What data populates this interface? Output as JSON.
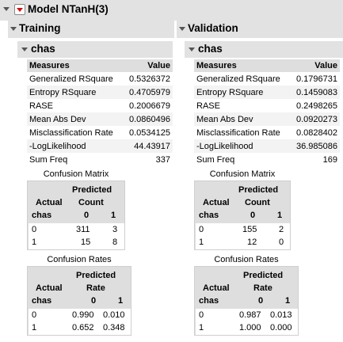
{
  "model": {
    "title": "Model NTanH(3)"
  },
  "panels": [
    {
      "title": "Training",
      "subtitle": "chas",
      "measures_header": "Measures",
      "value_header": "Value",
      "measures": [
        {
          "name": "Generalized RSquare",
          "value": "0.5326372"
        },
        {
          "name": "Entropy RSquare",
          "value": "0.4705979"
        },
        {
          "name": "RASE",
          "value": "0.2006679"
        },
        {
          "name": "Mean Abs Dev",
          "value": "0.0860496"
        },
        {
          "name": "Misclassification Rate",
          "value": "0.0534125"
        },
        {
          "name": "-LogLikelihood",
          "value": "44.43917"
        },
        {
          "name": "Sum Freq",
          "value": "337"
        }
      ],
      "confusion_matrix": {
        "caption": "Confusion Matrix",
        "predicted_label": "Predicted",
        "measure_label": "Count",
        "actual_label": "Actual",
        "row_var": "chas",
        "cols": [
          "0",
          "1"
        ],
        "rows": [
          {
            "label": "0",
            "values": [
              "311",
              "3"
            ]
          },
          {
            "label": "1",
            "values": [
              "15",
              "8"
            ]
          }
        ]
      },
      "confusion_rates": {
        "caption": "Confusion Rates",
        "predicted_label": "Predicted",
        "measure_label": "Rate",
        "actual_label": "Actual",
        "row_var": "chas",
        "cols": [
          "0",
          "1"
        ],
        "rows": [
          {
            "label": "0",
            "values": [
              "0.990",
              "0.010"
            ]
          },
          {
            "label": "1",
            "values": [
              "0.652",
              "0.348"
            ]
          }
        ]
      }
    },
    {
      "title": "Validation",
      "subtitle": "chas",
      "measures_header": "Measures",
      "value_header": "Value",
      "measures": [
        {
          "name": "Generalized RSquare",
          "value": "0.1796731"
        },
        {
          "name": "Entropy RSquare",
          "value": "0.1459083"
        },
        {
          "name": "RASE",
          "value": "0.2498265"
        },
        {
          "name": "Mean Abs Dev",
          "value": "0.0920273"
        },
        {
          "name": "Misclassification Rate",
          "value": "0.0828402"
        },
        {
          "name": "-LogLikelihood",
          "value": "36.985086"
        },
        {
          "name": "Sum Freq",
          "value": "169"
        }
      ],
      "confusion_matrix": {
        "caption": "Confusion Matrix",
        "predicted_label": "Predicted",
        "measure_label": "Count",
        "actual_label": "Actual",
        "row_var": "chas",
        "cols": [
          "0",
          "1"
        ],
        "rows": [
          {
            "label": "0",
            "values": [
              "155",
              "2"
            ]
          },
          {
            "label": "1",
            "values": [
              "12",
              "0"
            ]
          }
        ]
      },
      "confusion_rates": {
        "caption": "Confusion Rates",
        "predicted_label": "Predicted",
        "measure_label": "Rate",
        "actual_label": "Actual",
        "row_var": "chas",
        "cols": [
          "0",
          "1"
        ],
        "rows": [
          {
            "label": "0",
            "values": [
              "0.987",
              "0.013"
            ]
          },
          {
            "label": "1",
            "values": [
              "1.000",
              "0.000"
            ]
          }
        ]
      }
    }
  ]
}
